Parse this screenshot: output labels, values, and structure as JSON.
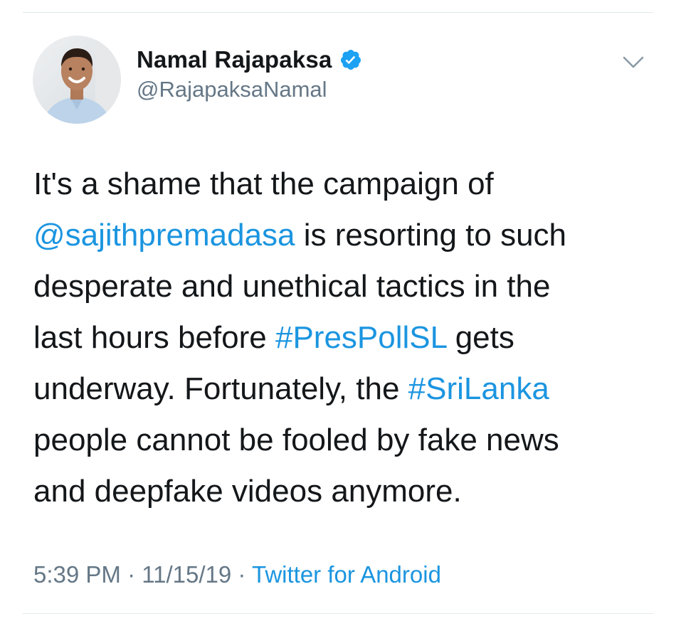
{
  "author": {
    "display_name": "Namal Rajapaksa",
    "handle": "@RajapaksaNamal",
    "verified": true,
    "avatar_icon": "profile-photo"
  },
  "icons": {
    "verified": "verified-badge-icon",
    "menu": "chevron-down-icon"
  },
  "tweet": {
    "segments": [
      {
        "text": "It's a shame that the campaign of\n",
        "type": "text"
      },
      {
        "text": "@sajithpremadasa",
        "type": "mention"
      },
      {
        "text": " is resorting to such\ndesperate and unethical tactics in the\nlast hours before ",
        "type": "text"
      },
      {
        "text": "#PresPollSL",
        "type": "hashtag"
      },
      {
        "text": " gets\nunderway. Fortunately, the ",
        "type": "text"
      },
      {
        "text": "#SriLanka",
        "type": "hashtag"
      },
      {
        "text": "\npeople cannot be fooled by fake news\nand deepfake videos anymore.",
        "type": "text"
      }
    ]
  },
  "meta": {
    "time": "5:39 PM",
    "separator": " · ",
    "date": "11/15/19",
    "source": "Twitter for Android"
  },
  "colors": {
    "link": "#1b95e0",
    "text": "#14171a",
    "secondary": "#657786",
    "verified": "#1da1f2",
    "divider": "#e1e8ed"
  }
}
